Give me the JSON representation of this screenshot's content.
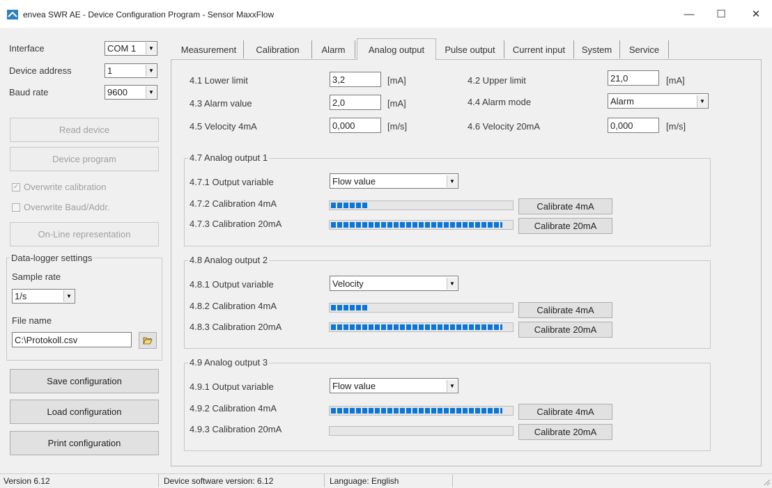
{
  "window": {
    "title": "envea SWR AE - Device Configuration Program - Sensor MaxxFlow",
    "minimize_glyph": "—",
    "maximize_glyph": "☐",
    "close_glyph": "✕"
  },
  "sidebar": {
    "interface_label": "Interface",
    "interface_value": "COM 1",
    "device_address_label": "Device address",
    "device_address_value": "1",
    "baud_rate_label": "Baud rate",
    "baud_rate_value": "9600",
    "read_device": "Read device",
    "device_program": "Device program",
    "overwrite_calibration": "Overwrite calibration",
    "overwrite_baud": "Overwrite Baud/Addr.",
    "online_representation": "On-Line representation",
    "datalogger_title": "Data-logger settings",
    "sample_rate_label": "Sample rate",
    "sample_rate_value": "1/s",
    "file_name_label": "File name",
    "file_name_value": "C:\\Protokoll.csv",
    "save_configuration": "Save configuration",
    "load_configuration": "Load configuration",
    "print_configuration": "Print configuration"
  },
  "tabs": [
    {
      "label": "Measurement"
    },
    {
      "label": "Calibration"
    },
    {
      "label": "Alarm"
    },
    {
      "label": "Analog output"
    },
    {
      "label": "Pulse output"
    },
    {
      "label": "Current input"
    },
    {
      "label": "System"
    },
    {
      "label": "Service"
    }
  ],
  "settings": {
    "lower_limit_label": "4.1 Lower limit",
    "lower_limit_value": "3,2",
    "upper_limit_label": "4.2 Upper limit",
    "upper_limit_value": "21,0",
    "alarm_value_label": "4.3 Alarm value",
    "alarm_value_value": "2,0",
    "alarm_mode_label": "4.4 Alarm mode",
    "alarm_mode_value": "Alarm",
    "velocity_4ma_label": "4.5 Velocity 4mA",
    "velocity_4ma_value": "0,000",
    "velocity_20ma_label": "4.6 Velocity 20mA",
    "velocity_20ma_value": "0,000",
    "unit_ma": "[mA]",
    "unit_ms": "[m/s]"
  },
  "outputs": [
    {
      "title": "4.7 Analog output 1",
      "var_label": "4.7.1 Output variable",
      "var_value": "Flow value",
      "cal4_label": "4.7.2 Calibration 4mA",
      "cal4_progress": 0.21,
      "cal20_label": "4.7.3 Calibration 20mA",
      "cal20_progress": 0.95,
      "cal4_button": "Calibrate 4mA",
      "cal20_button": "Calibrate 20mA"
    },
    {
      "title": "4.8 Analog output 2",
      "var_label": "4.8.1 Output variable",
      "var_value": "Velocity",
      "cal4_label": "4.8.2 Calibration 4mA",
      "cal4_progress": 0.21,
      "cal20_label": "4.8.3 Calibration 20mA",
      "cal20_progress": 0.95,
      "cal4_button": "Calibrate 4mA",
      "cal20_button": "Calibrate 20mA"
    },
    {
      "title": "4.9 Analog output 3",
      "var_label": "4.9.1 Output variable",
      "var_value": "Flow value",
      "cal4_label": "4.9.2 Calibration 4mA",
      "cal4_progress": 0.95,
      "cal20_label": "4.9.3 Calibration 20mA",
      "cal20_progress": 0.0,
      "cal4_button": "Calibrate 4mA",
      "cal20_button": "Calibrate 20mA"
    }
  ],
  "statusbar": {
    "version": "Version 6.12",
    "device_software": "Device software version: 6.12",
    "language": "Language: English"
  },
  "colors": {
    "progress_fill": "#0a76d8",
    "app_icon": "#2f7fc1"
  },
  "icons": {
    "app": "envea-logo-icon",
    "folder": "folder-open-icon",
    "dropdown": "chevron-down-icon"
  }
}
